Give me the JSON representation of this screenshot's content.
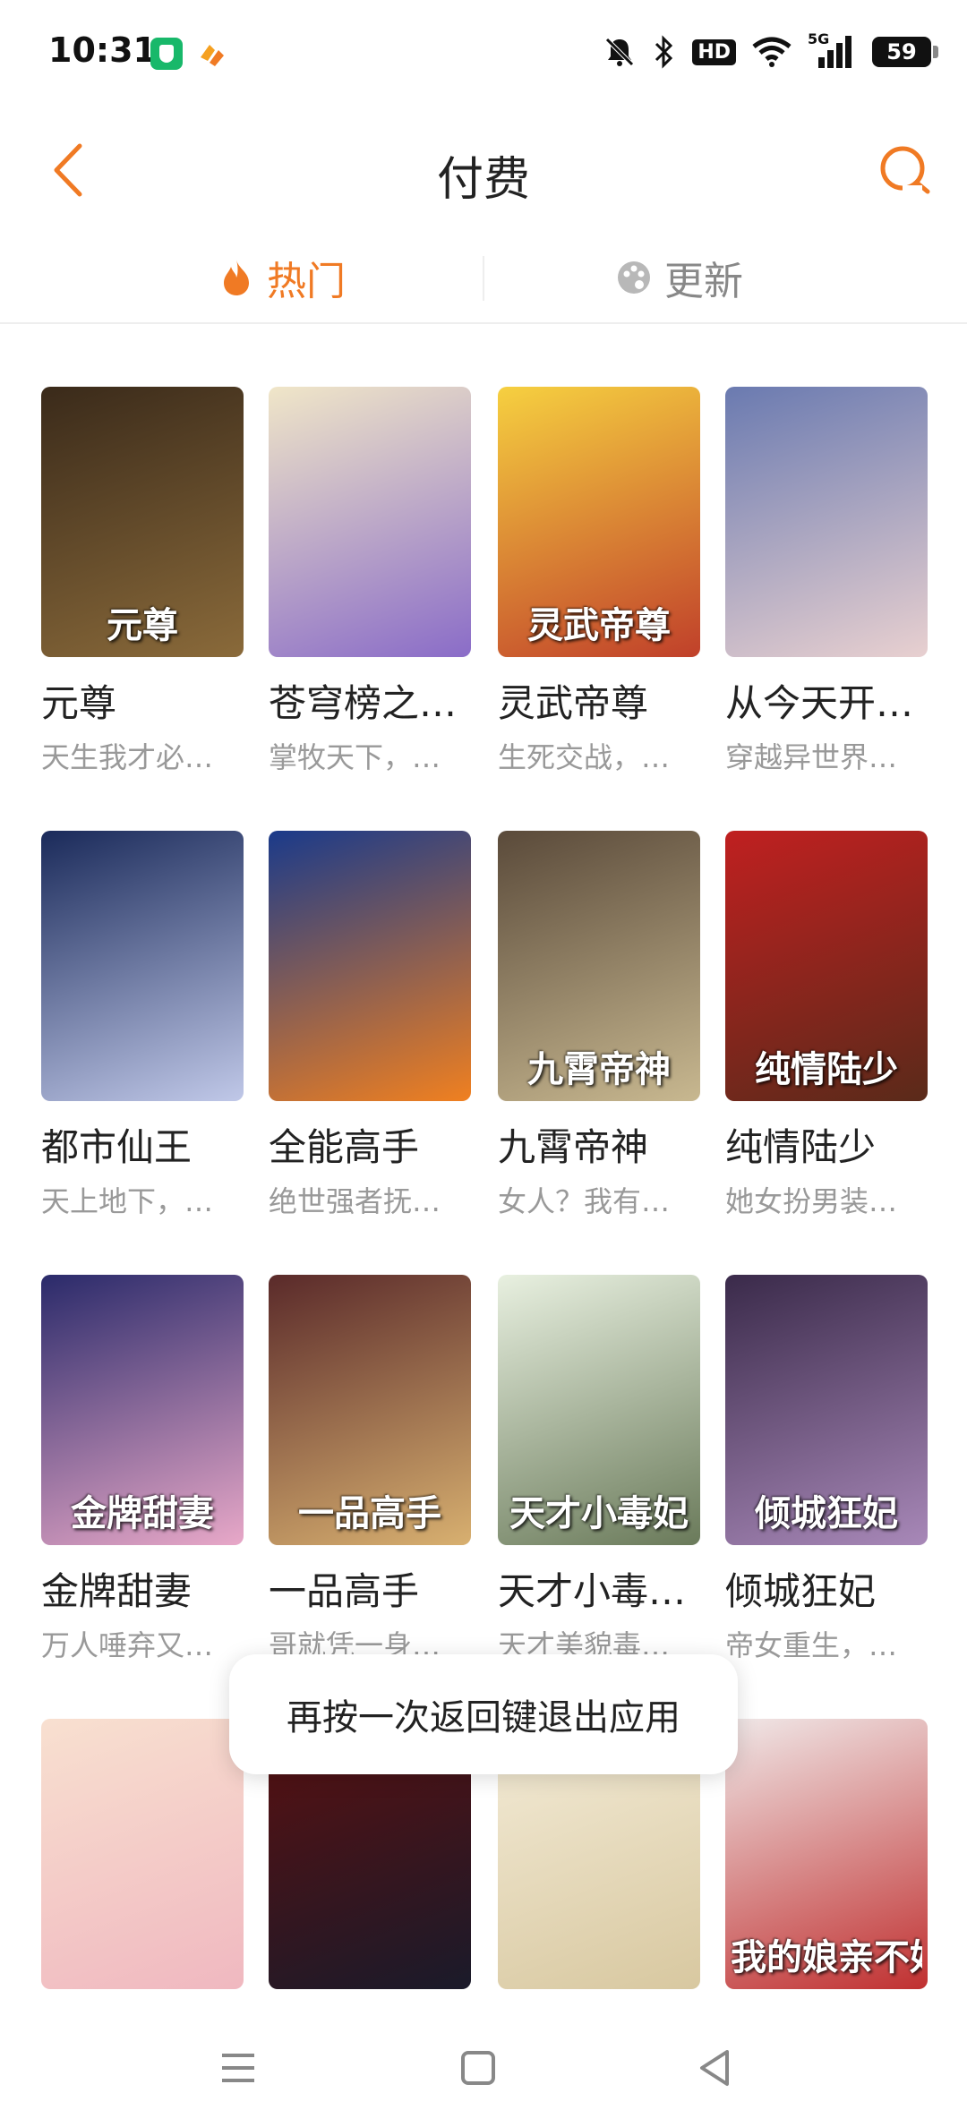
{
  "status_bar": {
    "time": "10:31",
    "network": "5G",
    "hd": "HD",
    "battery": "59"
  },
  "header": {
    "title": "付费",
    "back_icon": "chevron-left-icon",
    "search_icon": "search-icon"
  },
  "tabs": [
    {
      "label": "热门",
      "icon": "flame-icon",
      "active": true
    },
    {
      "label": "更新",
      "icon": "palette-icon",
      "active": false
    }
  ],
  "colors": {
    "accent": "#f07a24",
    "muted": "#999999"
  },
  "comics": [
    {
      "title": "元尊",
      "desc": "天生我才必…",
      "cover_text": "元尊",
      "gradient": [
        "#3a2a1a",
        "#8a6a3a"
      ]
    },
    {
      "title": "苍穹榜之…",
      "desc": "掌牧天下，…",
      "cover_text": "",
      "gradient": [
        "#f0e6c8",
        "#8a6cc8"
      ]
    },
    {
      "title": "灵武帝尊",
      "desc": "生死交战，…",
      "cover_text": "灵武帝尊",
      "gradient": [
        "#f6d040",
        "#c0402a"
      ]
    },
    {
      "title": "从今天开…",
      "desc": "穿越异世界…",
      "cover_text": "",
      "gradient": [
        "#6a7ab0",
        "#e8d0d0"
      ]
    },
    {
      "title": "都市仙王",
      "desc": "天上地下，…",
      "cover_text": "",
      "gradient": [
        "#1a2a5a",
        "#c0c8e8"
      ]
    },
    {
      "title": "全能高手",
      "desc": "绝世强者抚…",
      "cover_text": "",
      "gradient": [
        "#1a3a8a",
        "#f08020"
      ]
    },
    {
      "title": "九霄帝神",
      "desc": "女人？我有…",
      "cover_text": "九霄帝神",
      "gradient": [
        "#5a4a3a",
        "#c8b890"
      ]
    },
    {
      "title": "纯情陆少",
      "desc": "她女扮男装…",
      "cover_text": "纯情陆少",
      "gradient": [
        "#c02020",
        "#5a2a1a"
      ]
    },
    {
      "title": "金牌甜妻",
      "desc": "万人唾弃又…",
      "cover_text": "金牌甜妻",
      "gradient": [
        "#2a2a6a",
        "#e8a8c8"
      ]
    },
    {
      "title": "一品高手",
      "desc": "哥就凭一身…",
      "cover_text": "一品高手",
      "gradient": [
        "#5a2a2a",
        "#d8b070"
      ]
    },
    {
      "title": "天才小毒…",
      "desc": "天才美貌毒…",
      "cover_text": "天才小毒妃",
      "gradient": [
        "#e8f0e0",
        "#6a7a5a"
      ]
    },
    {
      "title": "倾城狂妃",
      "desc": "帝女重生，…",
      "cover_text": "倾城狂妃",
      "gradient": [
        "#3a2a4a",
        "#a888b8"
      ]
    },
    {
      "title": "",
      "desc": "",
      "cover_text": "",
      "gradient": [
        "#f8e0d0",
        "#f0b8c0"
      ]
    },
    {
      "title": "",
      "desc": "",
      "cover_text": "",
      "gradient": [
        "#5a1010",
        "#1a1a2a"
      ]
    },
    {
      "title": "",
      "desc": "",
      "cover_text": "",
      "gradient": [
        "#f4ecd8",
        "#d8c8a0"
      ]
    },
    {
      "title": "",
      "desc": "",
      "cover_text": "我的娘亲不好惹",
      "gradient": [
        "#f0e8e8",
        "#c03030"
      ]
    }
  ],
  "toast": {
    "message": "再按一次返回键退出应用"
  },
  "nav": {
    "menu_icon": "menu-icon",
    "home_icon": "home-square-icon",
    "back_icon": "back-triangle-icon"
  }
}
